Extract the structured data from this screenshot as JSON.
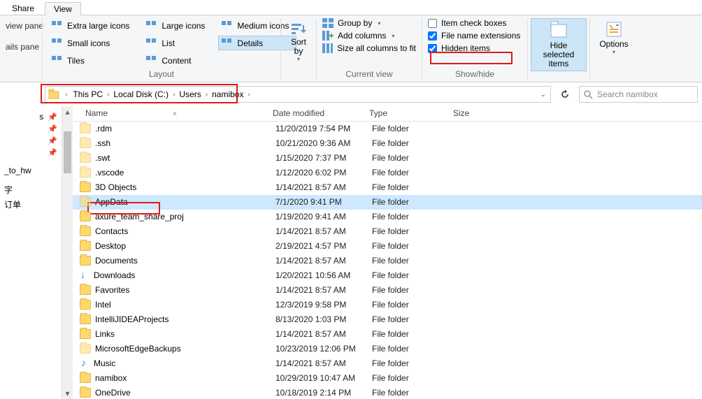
{
  "tabs": {
    "share": "Share",
    "view": "View"
  },
  "panes": {
    "view": "view pane",
    "details": "ails pane"
  },
  "layout": {
    "label": "Layout",
    "items": [
      "Extra large icons",
      "Large icons",
      "Medium icons",
      "Small icons",
      "List",
      "Details",
      "Tiles",
      "Content"
    ]
  },
  "sort": {
    "label": "Sort\nby"
  },
  "current_view": {
    "label": "Current view",
    "group_by": "Group by",
    "add_cols": "Add columns",
    "size_cols": "Size all columns to fit"
  },
  "showhide": {
    "label": "Show/hide",
    "item_check": "Item check boxes",
    "file_ext": "File name extensions",
    "hidden": "Hidden items"
  },
  "hide_selected": {
    "line1": "Hide selected",
    "line2": "items"
  },
  "options": "Options",
  "breadcrumb": [
    "This PC",
    "Local Disk (C:)",
    "Users",
    "namibox"
  ],
  "search_placeholder": "Search namibox",
  "quick_access": {
    "to_hw": "_to_hw",
    "cn1": "字",
    "cn2": "订单"
  },
  "columns": {
    "name": "Name",
    "date": "Date modified",
    "type": "Type",
    "size": "Size"
  },
  "type_folder": "File folder",
  "files": [
    {
      "name": ".rdm",
      "date": "11/20/2019 7:54 PM",
      "kind": "hidden"
    },
    {
      "name": ".ssh",
      "date": "10/21/2020 9:36 AM",
      "kind": "hidden"
    },
    {
      "name": ".swt",
      "date": "1/15/2020 7:37 PM",
      "kind": "hidden"
    },
    {
      "name": ".vscode",
      "date": "1/12/2020 6:02 PM",
      "kind": "hidden"
    },
    {
      "name": "3D Objects",
      "date": "1/14/2021 8:57 AM",
      "kind": "sys"
    },
    {
      "name": "AppData",
      "date": "7/1/2020 9:41 PM",
      "kind": "hidden",
      "selected": true
    },
    {
      "name": "axure_team_share_proj",
      "date": "1/19/2020 9:41 AM",
      "kind": "folder"
    },
    {
      "name": "Contacts",
      "date": "1/14/2021 8:57 AM",
      "kind": "sys"
    },
    {
      "name": "Desktop",
      "date": "2/19/2021 4:57 PM",
      "kind": "sys"
    },
    {
      "name": "Documents",
      "date": "1/14/2021 8:57 AM",
      "kind": "sys"
    },
    {
      "name": "Downloads",
      "date": "1/20/2021 10:56 AM",
      "kind": "dl"
    },
    {
      "name": "Favorites",
      "date": "1/14/2021 8:57 AM",
      "kind": "sys"
    },
    {
      "name": "Intel",
      "date": "12/3/2019 9:58 PM",
      "kind": "folder"
    },
    {
      "name": "IntelliJIDEAProjects",
      "date": "8/13/2020 1:03 PM",
      "kind": "folder"
    },
    {
      "name": "Links",
      "date": "1/14/2021 8:57 AM",
      "kind": "sys"
    },
    {
      "name": "MicrosoftEdgeBackups",
      "date": "10/23/2019 12:06 PM",
      "kind": "hidden"
    },
    {
      "name": "Music",
      "date": "1/14/2021 8:57 AM",
      "kind": "music"
    },
    {
      "name": "namibox",
      "date": "10/29/2019 10:47 AM",
      "kind": "folder"
    },
    {
      "name": "OneDrive",
      "date": "10/18/2019 2:14 PM",
      "kind": "folder"
    }
  ]
}
